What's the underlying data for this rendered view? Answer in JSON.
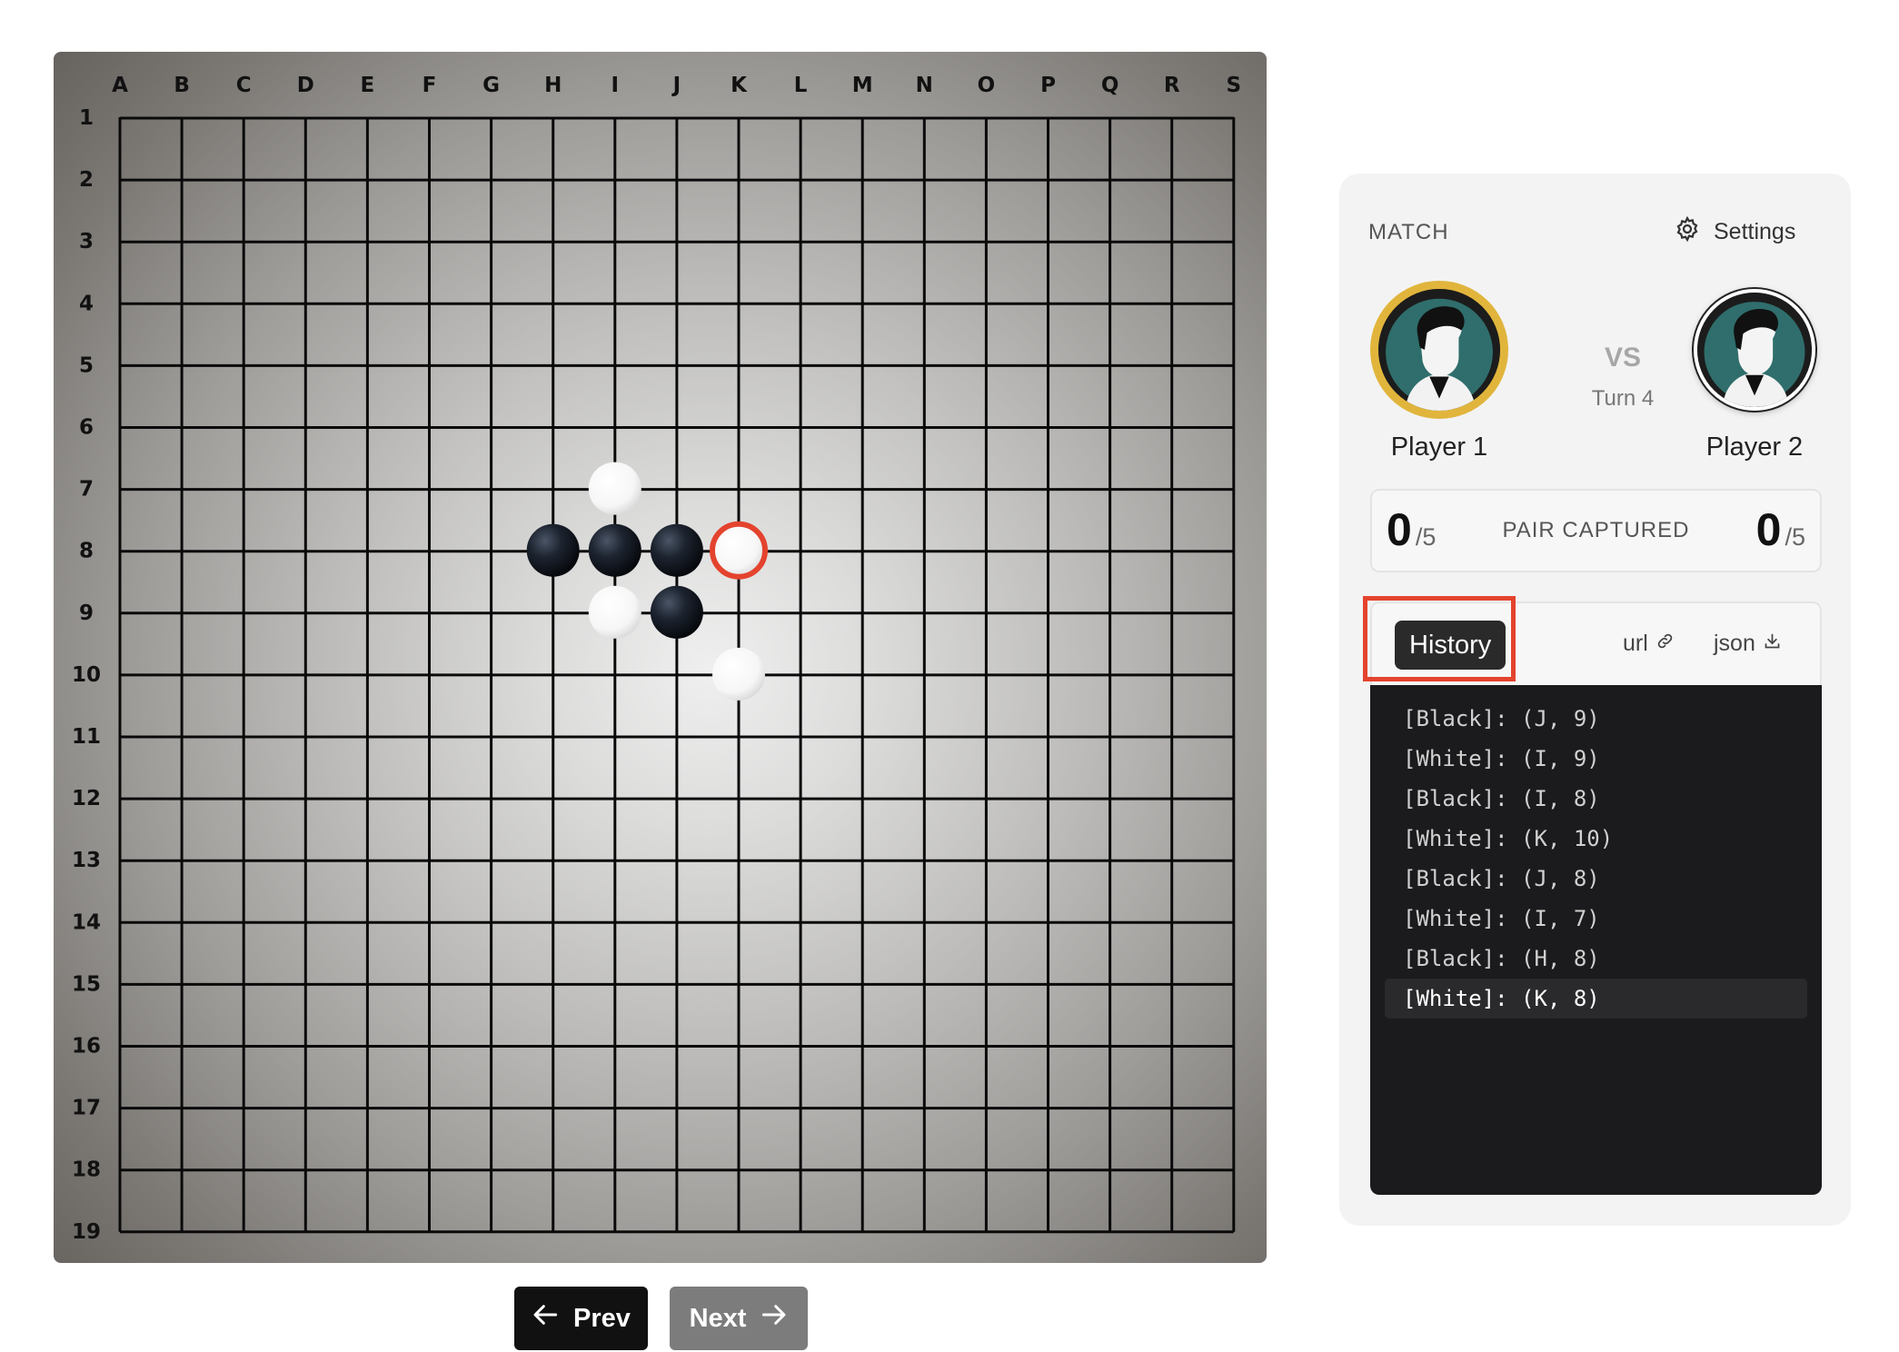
{
  "board": {
    "columns": [
      "A",
      "B",
      "C",
      "D",
      "E",
      "F",
      "G",
      "H",
      "I",
      "J",
      "K",
      "L",
      "M",
      "N",
      "O",
      "P",
      "Q",
      "R",
      "S"
    ],
    "rows": [
      "1",
      "2",
      "3",
      "4",
      "5",
      "6",
      "7",
      "8",
      "9",
      "10",
      "11",
      "12",
      "13",
      "14",
      "15",
      "16",
      "17",
      "18",
      "19"
    ],
    "stones": [
      {
        "color": "white",
        "col": "I",
        "row": 7,
        "last": false
      },
      {
        "color": "black",
        "col": "H",
        "row": 8,
        "last": false
      },
      {
        "color": "black",
        "col": "I",
        "row": 8,
        "last": false
      },
      {
        "color": "black",
        "col": "J",
        "row": 8,
        "last": false
      },
      {
        "color": "white",
        "col": "K",
        "row": 8,
        "last": true
      },
      {
        "color": "white",
        "col": "I",
        "row": 9,
        "last": false
      },
      {
        "color": "black",
        "col": "J",
        "row": 9,
        "last": false
      },
      {
        "color": "white",
        "col": "K",
        "row": 10,
        "last": false
      }
    ]
  },
  "panel": {
    "match_label": "MATCH",
    "settings_label": "Settings",
    "vs_label": "VS",
    "turn_label": "Turn 4",
    "player1": {
      "name": "Player 1",
      "captured": "0",
      "max": "/5"
    },
    "player2": {
      "name": "Player 2",
      "captured": "0",
      "max": "/5"
    },
    "pair_captured_label": "PAIR CAPTURED",
    "history_tab": "History",
    "url_label": "url",
    "json_label": "json",
    "history": [
      {
        "text": "[Black]: (J, 9)",
        "current": false
      },
      {
        "text": "[White]: (I, 9)",
        "current": false
      },
      {
        "text": "[Black]: (I, 8)",
        "current": false
      },
      {
        "text": "[White]: (K, 10)",
        "current": false
      },
      {
        "text": "[Black]: (J, 8)",
        "current": false
      },
      {
        "text": "[White]: (I, 7)",
        "current": false
      },
      {
        "text": "[Black]: (H, 8)",
        "current": false
      },
      {
        "text": "[White]: (K, 8)",
        "current": true
      }
    ]
  },
  "nav": {
    "prev_label": "Prev",
    "next_label": "Next"
  },
  "colors": {
    "accent_gold": "#e1b53c",
    "last_move_ring": "#e4432e",
    "highlight_box": "#e4432e"
  }
}
